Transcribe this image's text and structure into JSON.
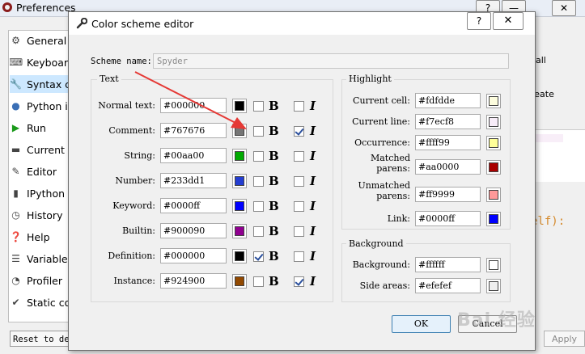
{
  "preferences": {
    "title": "Preferences",
    "sidebar": [
      {
        "label": "General",
        "icon": "gears-icon"
      },
      {
        "label": "Keyboard",
        "icon": "keyboard-icon"
      },
      {
        "label": "Syntax c",
        "icon": "wrench-icon"
      },
      {
        "label": "Python i",
        "icon": "python-icon"
      },
      {
        "label": "Run",
        "icon": "run-icon"
      },
      {
        "label": "Current",
        "icon": "folder-icon"
      },
      {
        "label": "Editor",
        "icon": "editor-icon"
      },
      {
        "label": "IPython",
        "icon": "ipython-icon"
      },
      {
        "label": "History",
        "icon": "history-icon"
      },
      {
        "label": "Help",
        "icon": "help-icon"
      },
      {
        "label": "Variable",
        "icon": "variable-icon"
      },
      {
        "label": "Profiler",
        "icon": "profiler-icon"
      },
      {
        "label": "Static co",
        "icon": "static-icon"
      }
    ],
    "reset_label": "Reset to defaults",
    "apply_label": "Apply",
    "right_all": "all",
    "right_create": "reate",
    "right_code": "elf):"
  },
  "dialog": {
    "title": "Color scheme editor",
    "help_label": "?",
    "close_label": "✕",
    "scheme_label": "Scheme name:",
    "scheme_value": "Spyder",
    "text_group": "Text",
    "text_rows": [
      {
        "label": "Normal text:",
        "value": "#000000",
        "color": "#000000",
        "bold": false,
        "italic": false
      },
      {
        "label": "Comment:",
        "value": "#767676",
        "color": "#767676",
        "bold": false,
        "italic": true
      },
      {
        "label": "String:",
        "value": "#00aa00",
        "color": "#00aa00",
        "bold": false,
        "italic": false
      },
      {
        "label": "Number:",
        "value": "#233dd1",
        "color": "#233dd1",
        "bold": false,
        "italic": false
      },
      {
        "label": "Keyword:",
        "value": "#0000ff",
        "color": "#0000ff",
        "bold": false,
        "italic": false
      },
      {
        "label": "Builtin:",
        "value": "#900090",
        "color": "#900090",
        "bold": false,
        "italic": false
      },
      {
        "label": "Definition:",
        "value": "#000000",
        "color": "#000000",
        "bold": true,
        "italic": false
      },
      {
        "label": "Instance:",
        "value": "#924900",
        "color": "#924900",
        "bold": false,
        "italic": true
      }
    ],
    "bold_glyph": "B",
    "italic_glyph": "I",
    "highlight_group": "Highlight",
    "highlight_rows": [
      {
        "label": "Current cell:",
        "value": "#fdfdde",
        "color": "#fdfdde"
      },
      {
        "label": "Current line:",
        "value": "#f7ecf8",
        "color": "#f7ecf8"
      },
      {
        "label": "Occurrence:",
        "value": "#ffff99",
        "color": "#ffff99"
      },
      {
        "label": "Matched\nparens:",
        "value": "#aa0000",
        "color": "#aa0000"
      },
      {
        "label": "Unmatched\nparens:",
        "value": "#ff9999",
        "color": "#ff9999"
      },
      {
        "label": "Link:",
        "value": "#0000ff",
        "color": "#0000ff"
      }
    ],
    "background_group": "Background",
    "background_rows": [
      {
        "label": "Background:",
        "value": "#ffffff",
        "color": "#ffffff"
      },
      {
        "label": "Side areas:",
        "value": "#efefef",
        "color": "#efefef"
      }
    ],
    "ok_label": "OK",
    "cancel_label": "Cancel"
  },
  "watermark": "Bai 经验",
  "arrow_color": "#e53935"
}
